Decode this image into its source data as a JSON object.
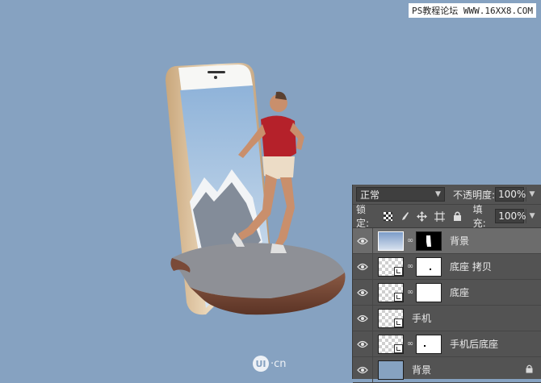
{
  "watermark": "PS教程论坛 WWW.16XX8.COM",
  "logo": {
    "mark": "UI",
    "text": "·cn"
  },
  "layers_panel": {
    "blend_mode": "正常",
    "opacity_label": "不透明度:",
    "opacity_value": "100%",
    "lock_label": "锁定:",
    "fill_label": "填充:",
    "fill_value": "100%",
    "layers": [
      {
        "name": "背景",
        "visible": true,
        "selected": true,
        "has_mask": true,
        "mask": "black"
      },
      {
        "name": "底座 拷贝",
        "visible": true,
        "selected": false,
        "has_mask": true,
        "mask": "white"
      },
      {
        "name": "底座",
        "visible": true,
        "selected": false,
        "has_mask": true,
        "mask": "white"
      },
      {
        "name": "手机",
        "visible": true,
        "selected": false,
        "has_mask": false
      },
      {
        "name": "手机后底座",
        "visible": true,
        "selected": false,
        "has_mask": true,
        "mask": "white"
      },
      {
        "name": "背景",
        "visible": true,
        "selected": false,
        "has_mask": false,
        "locked": true
      }
    ]
  },
  "colors": {
    "canvas_bg": "#86a2c1",
    "panel_bg": "#535353",
    "selected_row": "#6c6c6c"
  }
}
